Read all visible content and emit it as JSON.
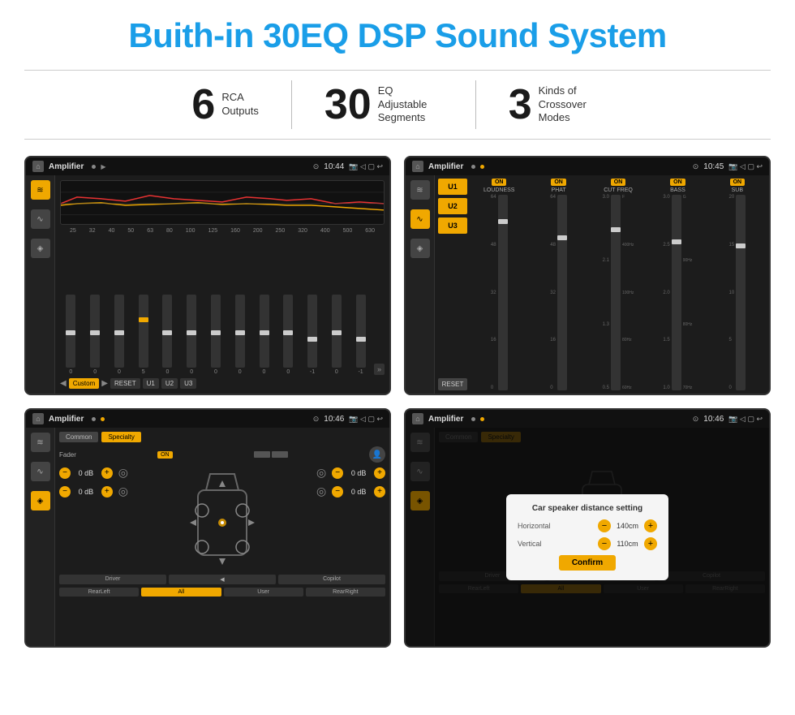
{
  "header": {
    "title": "Buith-in 30EQ DSP Sound System"
  },
  "stats": [
    {
      "number": "6",
      "label": "RCA\nOutputs"
    },
    {
      "number": "30",
      "label": "EQ Adjustable\nSegments"
    },
    {
      "number": "3",
      "label": "Kinds of\nCrossover Modes"
    }
  ],
  "screens": {
    "eq": {
      "app_name": "Amplifier",
      "time": "10:44",
      "freq_labels": [
        "25",
        "32",
        "40",
        "50",
        "63",
        "80",
        "100",
        "125",
        "160",
        "200",
        "250",
        "320",
        "400",
        "500",
        "630"
      ],
      "slider_values": [
        "0",
        "0",
        "0",
        "5",
        "0",
        "0",
        "0",
        "0",
        "0",
        "0",
        "-1",
        "0",
        "-1"
      ],
      "bottom_buttons": [
        "Custom",
        "RESET",
        "U1",
        "U2",
        "U3"
      ]
    },
    "crossover": {
      "app_name": "Amplifier",
      "time": "10:45",
      "u_buttons": [
        "U1",
        "U2",
        "U3"
      ],
      "columns": [
        {
          "label": "LOUDNESS",
          "on": true
        },
        {
          "label": "PHAT",
          "on": true
        },
        {
          "label": "CUT FREQ",
          "on": true
        },
        {
          "label": "BASS",
          "on": true
        },
        {
          "label": "SUB",
          "on": true
        }
      ],
      "reset_label": "RESET"
    },
    "fader": {
      "app_name": "Amplifier",
      "time": "10:46",
      "tabs": [
        "Common",
        "Specialty"
      ],
      "fader_label": "Fader",
      "on_label": "ON",
      "db_values": [
        "0 dB",
        "0 dB",
        "0 dB",
        "0 dB"
      ],
      "bottom_buttons": [
        "Driver",
        "",
        "Copilot",
        "RearLeft",
        "All",
        "User",
        "RearRight"
      ]
    },
    "dialog": {
      "app_name": "Amplifier",
      "time": "10:46",
      "tabs": [
        "Common",
        "Specialty"
      ],
      "dialog_title": "Car speaker distance setting",
      "horizontal_label": "Horizontal",
      "horizontal_value": "140cm",
      "vertical_label": "Vertical",
      "vertical_value": "110cm",
      "confirm_label": "Confirm",
      "db_values": [
        "0 dB",
        "0 dB"
      ],
      "bottom_buttons": [
        "Driver",
        "",
        "Copilot",
        "RearLeft",
        "All",
        "User",
        "RearRight"
      ]
    }
  },
  "icons": {
    "home": "⌂",
    "eq": "≋",
    "wave": "∿",
    "speaker": "◈",
    "settings": "⚙",
    "location": "⊙",
    "camera": "◉",
    "volume": "▶",
    "back": "↩",
    "minus": "−",
    "plus": "+"
  }
}
